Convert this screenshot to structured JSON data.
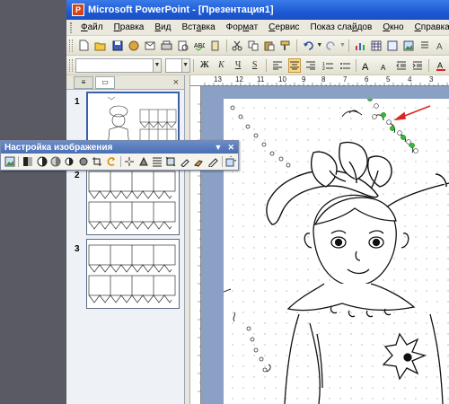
{
  "window": {
    "title": "Microsoft PowerPoint - [Презентация1]"
  },
  "menubar": {
    "items": [
      {
        "pre": "",
        "u": "Ф",
        "post": "айл"
      },
      {
        "pre": "",
        "u": "П",
        "post": "равка"
      },
      {
        "pre": "",
        "u": "В",
        "post": "ид"
      },
      {
        "pre": "Вст",
        "u": "а",
        "post": "вка"
      },
      {
        "pre": "Фор",
        "u": "м",
        "post": "ат"
      },
      {
        "pre": "",
        "u": "С",
        "post": "ервис"
      },
      {
        "pre": "Показ сла",
        "u": "й",
        "post": "дов"
      },
      {
        "pre": "",
        "u": "О",
        "post": "кно"
      },
      {
        "pre": "",
        "u": "С",
        "post": "правка"
      }
    ]
  },
  "toolbar_format": {
    "bold": "Ж",
    "italic": "К",
    "underline": "Ч",
    "shadow": "S"
  },
  "thumbnails": {
    "slides": [
      {
        "number": "1"
      },
      {
        "number": "2"
      },
      {
        "number": "3"
      }
    ],
    "close_glyph": "×"
  },
  "ruler": {
    "labels": [
      "13",
      "12",
      "11",
      "10",
      "9",
      "8",
      "7",
      "6",
      "5",
      "4",
      "3"
    ]
  },
  "picture_toolbar": {
    "title": "Настройка изображения"
  },
  "colors": {
    "titlebar": "#1d5ad6",
    "slide_bg": "#ffffff",
    "workspace": "#8aa0c4",
    "selection_handle": "#22bb22",
    "arrow": "#d9271f"
  }
}
